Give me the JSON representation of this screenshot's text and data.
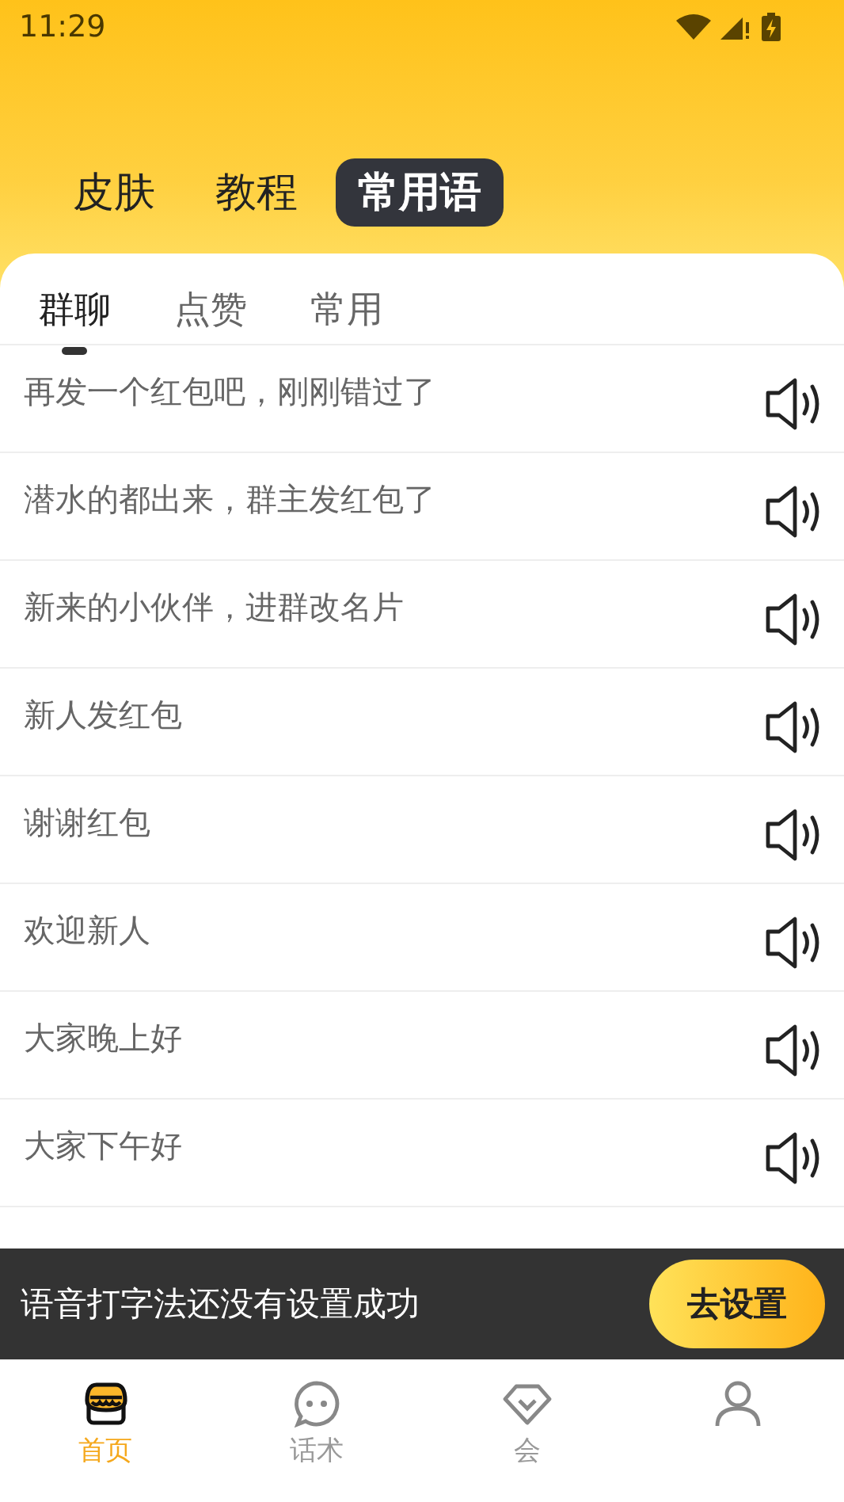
{
  "status_bar": {
    "time": "11:29"
  },
  "top_tabs": [
    {
      "label": "皮肤",
      "selected": false
    },
    {
      "label": "教程",
      "selected": false
    },
    {
      "label": "常用语",
      "selected": true
    }
  ],
  "sub_tabs": [
    {
      "label": "群聊",
      "selected": true
    },
    {
      "label": "点赞",
      "selected": false
    },
    {
      "label": "常用",
      "selected": false
    }
  ],
  "phrases": [
    {
      "text": "再发一个红包吧，刚刚错过了"
    },
    {
      "text": "潜水的都出来，群主发红包了"
    },
    {
      "text": "新来的小伙伴，进群改名片"
    },
    {
      "text": "新人发红包"
    },
    {
      "text": "谢谢红包"
    },
    {
      "text": "欢迎新人"
    },
    {
      "text": "大家晚上好"
    },
    {
      "text": "大家下午好"
    }
  ],
  "banner": {
    "message": "语音打字法还没有设置成功",
    "button": "去设置"
  },
  "bottom_nav": [
    {
      "kind": "shop",
      "label": "首页",
      "selected": true
    },
    {
      "kind": "chat",
      "label": "话术",
      "selected": false
    },
    {
      "kind": "diamond",
      "label": "会",
      "selected": false
    },
    {
      "kind": "person",
      "selected": false
    }
  ]
}
